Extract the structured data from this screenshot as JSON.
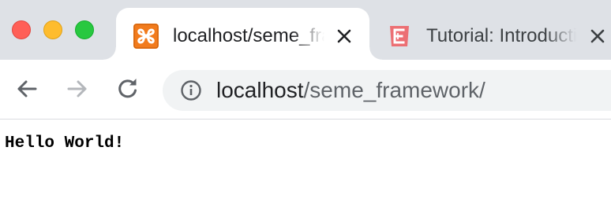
{
  "window": {
    "controls": [
      "close",
      "minimize",
      "zoom"
    ]
  },
  "tabs": [
    {
      "title": "localhost/seme_framework/",
      "favicon": "xampp-icon",
      "active": true
    },
    {
      "title": "Tutorial: Introduction",
      "favicon": "brackets-f-icon",
      "active": false
    }
  ],
  "toolbar": {
    "back_icon": "arrow-left-icon",
    "forward_icon": "arrow-right-icon",
    "reload_icon": "reload-icon"
  },
  "address_bar": {
    "host": "localhost",
    "path": "/seme_framework/",
    "site_info_icon": "info-icon"
  },
  "page": {
    "body_text": "Hello World!"
  },
  "colors": {
    "tab_strip": "#dee1e6",
    "omnibox": "#f1f3f4",
    "xampp_orange": "#f27b1c",
    "tutorial_red": "#ee5a5e"
  }
}
